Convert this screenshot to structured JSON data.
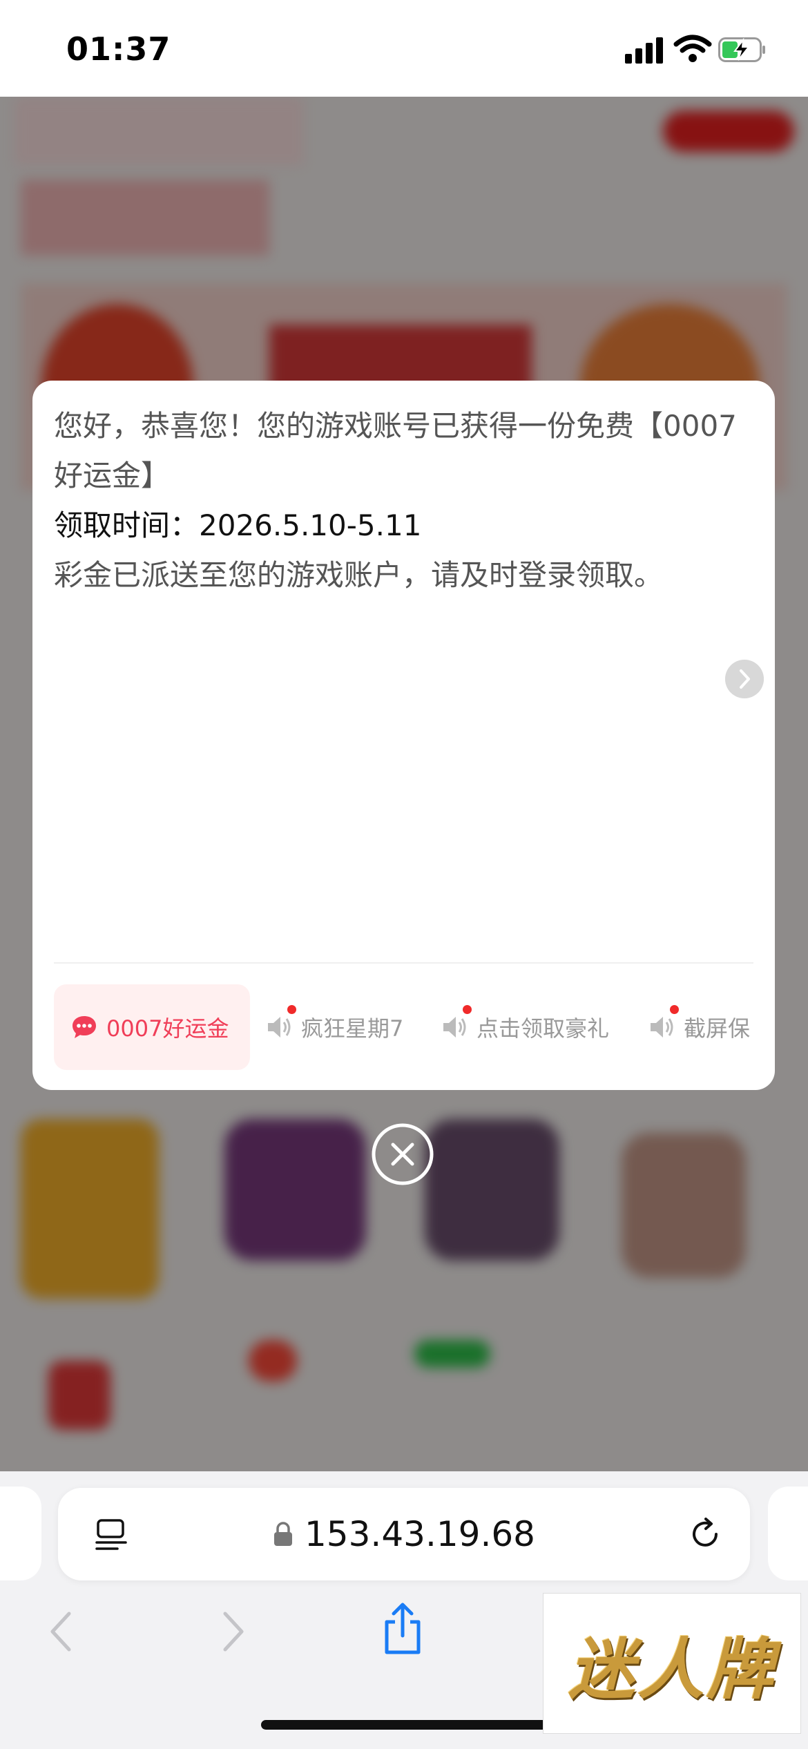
{
  "status_bar": {
    "time": "01:37"
  },
  "modal": {
    "message_line1": "您好，恭喜您！您的游戏账号已获得一份免费【0007好运金】",
    "message_line2": "领取时间：2026.5.10-5.11",
    "message_line3": "彩金已派送至您的游戏账户，请及时登录领取。",
    "tabs": [
      {
        "label": "0007好运金",
        "icon": "chat-bubble-icon",
        "active": true
      },
      {
        "label": "疯狂星期7",
        "icon": "speaker-icon",
        "active": false
      },
      {
        "label": "点击领取豪礼",
        "icon": "speaker-icon",
        "active": false
      },
      {
        "label": "截屏保",
        "icon": "speaker-icon",
        "active": false
      }
    ]
  },
  "browser": {
    "url": "153.43.19.68",
    "toolbar_icons": [
      "back-icon",
      "forward-icon",
      "share-icon"
    ]
  },
  "watermark": {
    "text": "迷人牌"
  },
  "colors": {
    "accent": "#f03e58",
    "tab_active_bg": "#fff0f0",
    "safari_blue": "#1a7cf5"
  }
}
